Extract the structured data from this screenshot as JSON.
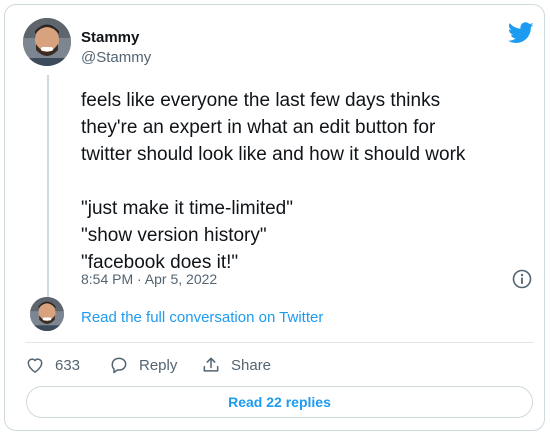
{
  "tweet": {
    "display_name": "Stammy",
    "handle": "@Stammy",
    "text_lines": [
      "feels like everyone the last few days thinks",
      "they're an expert in what an edit button for",
      "twitter should look like and how it should work",
      "\"just make it time-limited\"",
      "\"show version history\"",
      "\"facebook does it!\""
    ],
    "timestamp": "8:54 PM · Apr 5, 2022"
  },
  "conversation_link": "Read the full conversation on Twitter",
  "actions": {
    "like_count": "633",
    "reply_label": "Reply",
    "share_label": "Share"
  },
  "replies_button": "Read 22 replies",
  "colors": {
    "accent": "#1d9bf0",
    "secondary_text": "#536471",
    "border": "#cfd9de"
  },
  "icons": [
    "avatar",
    "twitter-bird-icon",
    "info-icon",
    "heart-icon",
    "reply-icon",
    "share-icon"
  ]
}
